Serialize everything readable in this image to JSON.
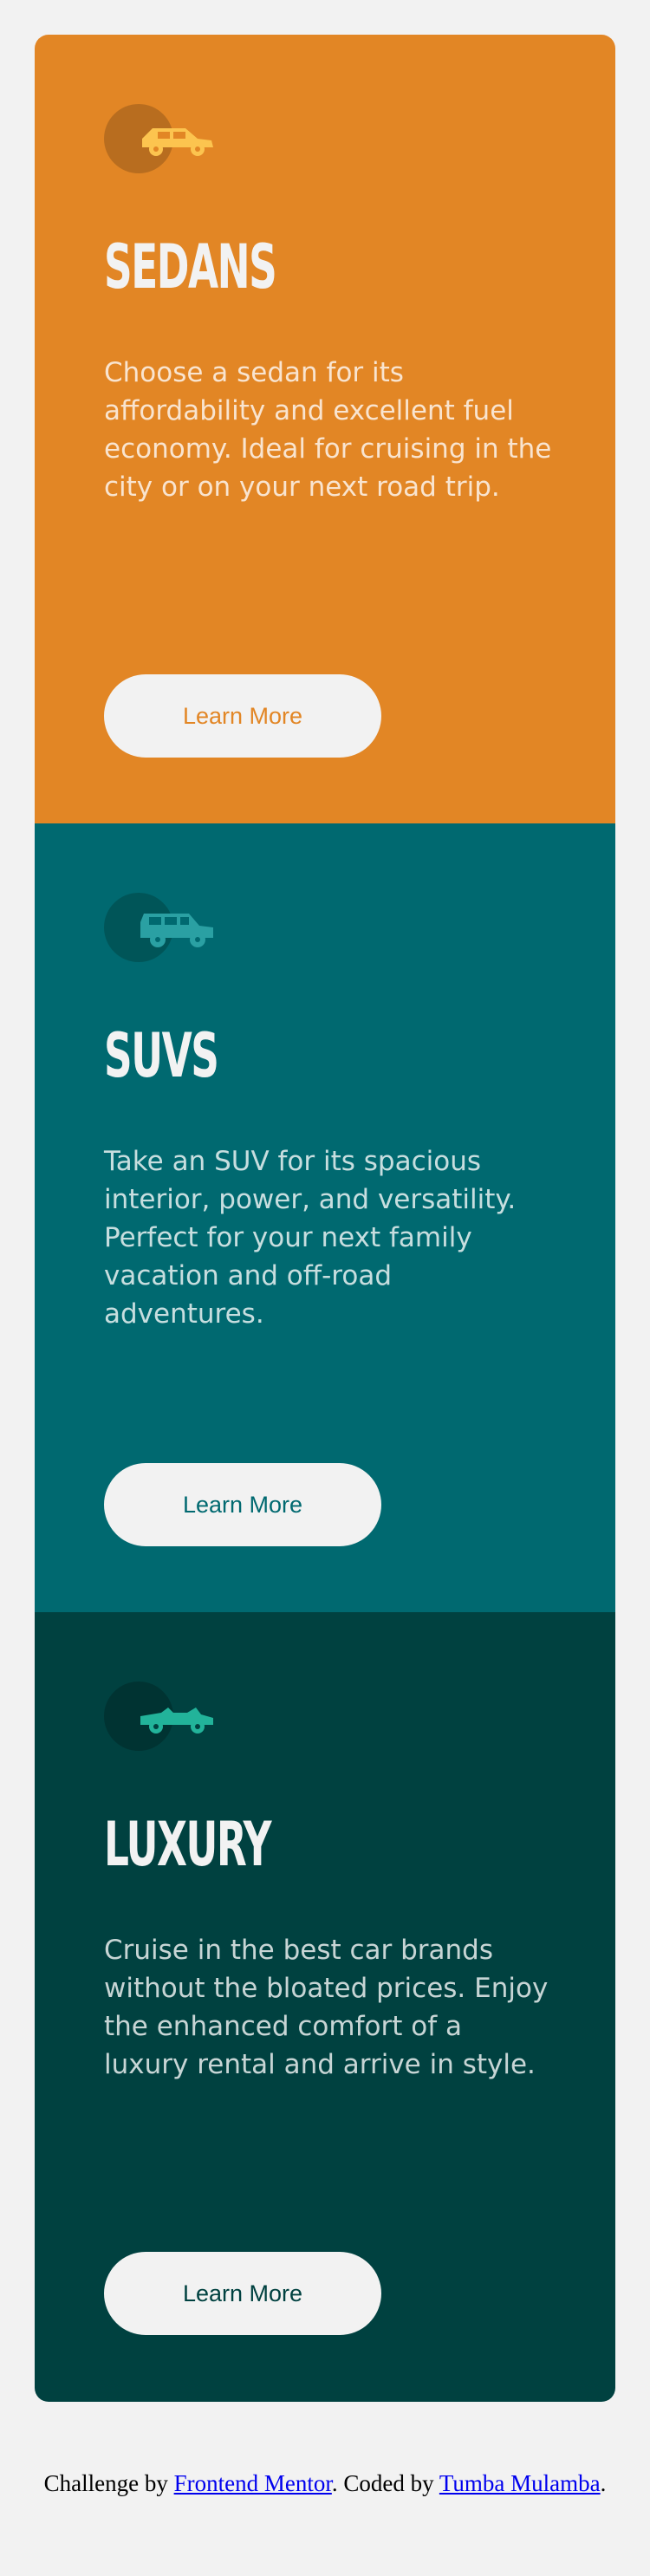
{
  "cards": [
    {
      "title": "SEDANS",
      "text": "Choose a sedan for its affordability and excellent fuel economy. Ideal for cruising in the city or on your next road trip.",
      "button_label": "Learn More",
      "icon": "sedan-icon",
      "accent": "#e28625",
      "icon_color": "#fcc44f"
    },
    {
      "title": "SUVS",
      "text": "Take an SUV for its spacious interior, power, and versatility. Perfect for your next family vacation and off-road adventures.",
      "button_label": "Learn More",
      "icon": "suv-icon",
      "accent": "#006970",
      "icon_color": "#2aa0a3"
    },
    {
      "title": "LUXURY",
      "text": "Cruise in the best car brands without the bloated prices. Enjoy the enhanced comfort of a luxury rental and arrive in style.",
      "button_label": "Learn More",
      "icon": "luxury-car-icon",
      "accent": "#004140",
      "icon_color": "#22b39a"
    }
  ],
  "attribution": {
    "prefix": "Challenge by ",
    "link1": "Frontend Mentor",
    "middle": ". Coded by ",
    "link2": "Tumba Mulamba",
    "suffix": "."
  },
  "colors": {
    "background": "#f2f2f2",
    "button_bg": "#f2f2f2",
    "link": "#0000ee"
  }
}
